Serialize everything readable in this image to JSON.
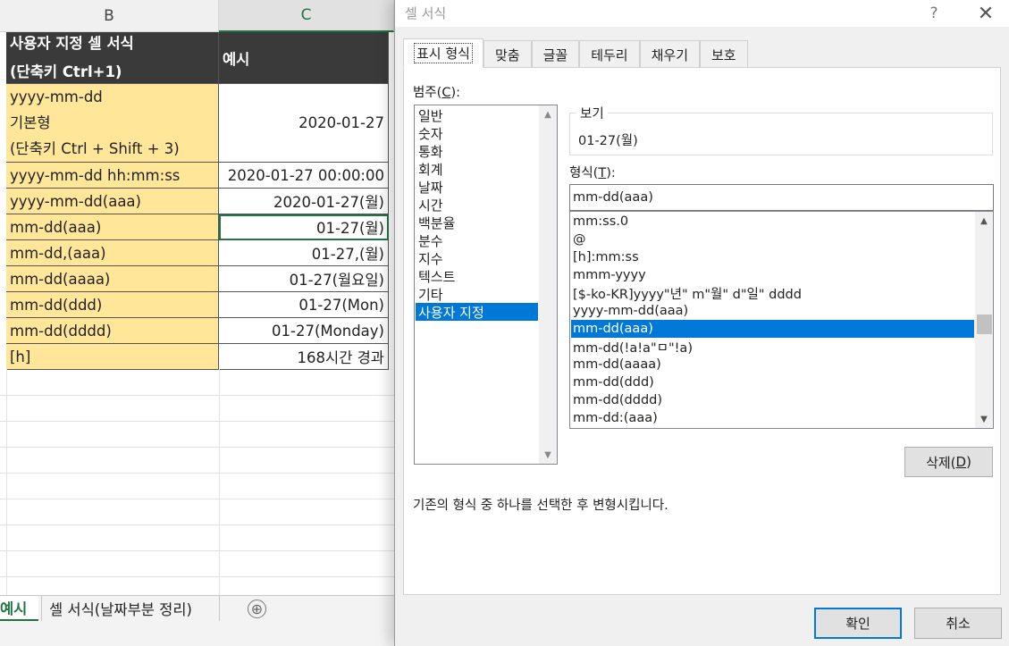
{
  "sheet": {
    "columns": [
      "B",
      "C"
    ],
    "header": {
      "b_line1": "사용자 지정 셀 서식",
      "b_line2": "(단축키 Ctrl+1)",
      "c": "예시"
    },
    "row1": {
      "b_line1": "yyyy-mm-dd",
      "b_line2": "기본형",
      "b_line3": "(단축키 Ctrl + Shift + 3)",
      "c": "2020-01-27"
    },
    "rows": [
      {
        "b": "yyyy-mm-dd hh:mm:ss",
        "c": "2020-01-27 00:00:00"
      },
      {
        "b": "yyyy-mm-dd(aaa)",
        "c": "2020-01-27(월)"
      },
      {
        "b": "mm-dd(aaa)",
        "c": "01-27(월)"
      },
      {
        "b": "mm-dd,(aaa)",
        "c": "01-27,(월)"
      },
      {
        "b": "mm-dd(aaaa)",
        "c": "01-27(월요일)"
      },
      {
        "b": "mm-dd(ddd)",
        "c": "01-27(Mon)"
      },
      {
        "b": "mm-dd(dddd)",
        "c": "01-27(Monday)"
      },
      {
        "b": "[h]",
        "c": "168시간 경과"
      }
    ],
    "tabs": [
      "예시",
      "셀 서식(날짜부분 정리)"
    ],
    "add_sheet": "⊕"
  },
  "dialog": {
    "title": "셀 서식",
    "help": "?",
    "close": "✕",
    "tabs": [
      "표시 형식",
      "맞춤",
      "글꼴",
      "테두리",
      "채우기",
      "보호"
    ],
    "category_label_text": "범주(",
    "category_label_key": "C",
    "category_label_end": "):",
    "categories": [
      "일반",
      "숫자",
      "통화",
      "회계",
      "날짜",
      "시간",
      "백분율",
      "분수",
      "지수",
      "텍스트",
      "기타",
      "사용자 지정"
    ],
    "selected_category": "사용자 지정",
    "preview_label": "보기",
    "preview_value": "01-27(월)",
    "format_label_text": "형식(",
    "format_label_key": "T",
    "format_label_end": "):",
    "format_input": "mm-dd(aaa)",
    "format_list": [
      "mm:ss.0",
      "@",
      "[h]:mm:ss",
      "mmm-yyyy",
      "[$-ko-KR]yyyy\"년\" m\"월\" d\"일\" dddd",
      "yyyy-mm-dd(aaa)",
      "mm-dd(aaa)",
      "mm-dd(!a!a\"ㅁ\"!a)",
      "mm-dd(aaaa)",
      "mm-dd(ddd)",
      "mm-dd(dddd)",
      "mm-dd:(aaa)"
    ],
    "selected_format": "mm-dd(aaa)",
    "delete_text": "삭제(",
    "delete_key": "D",
    "delete_end": ")",
    "hint": "기존의 형식 중 하나를 선택한 후 변형시킵니다.",
    "ok": "확인",
    "cancel": "취소"
  },
  "colors": {
    "accent": "#217346",
    "highlight": "#0078d7",
    "format_cell": "#ffe699",
    "header": "#3a3a3a"
  }
}
